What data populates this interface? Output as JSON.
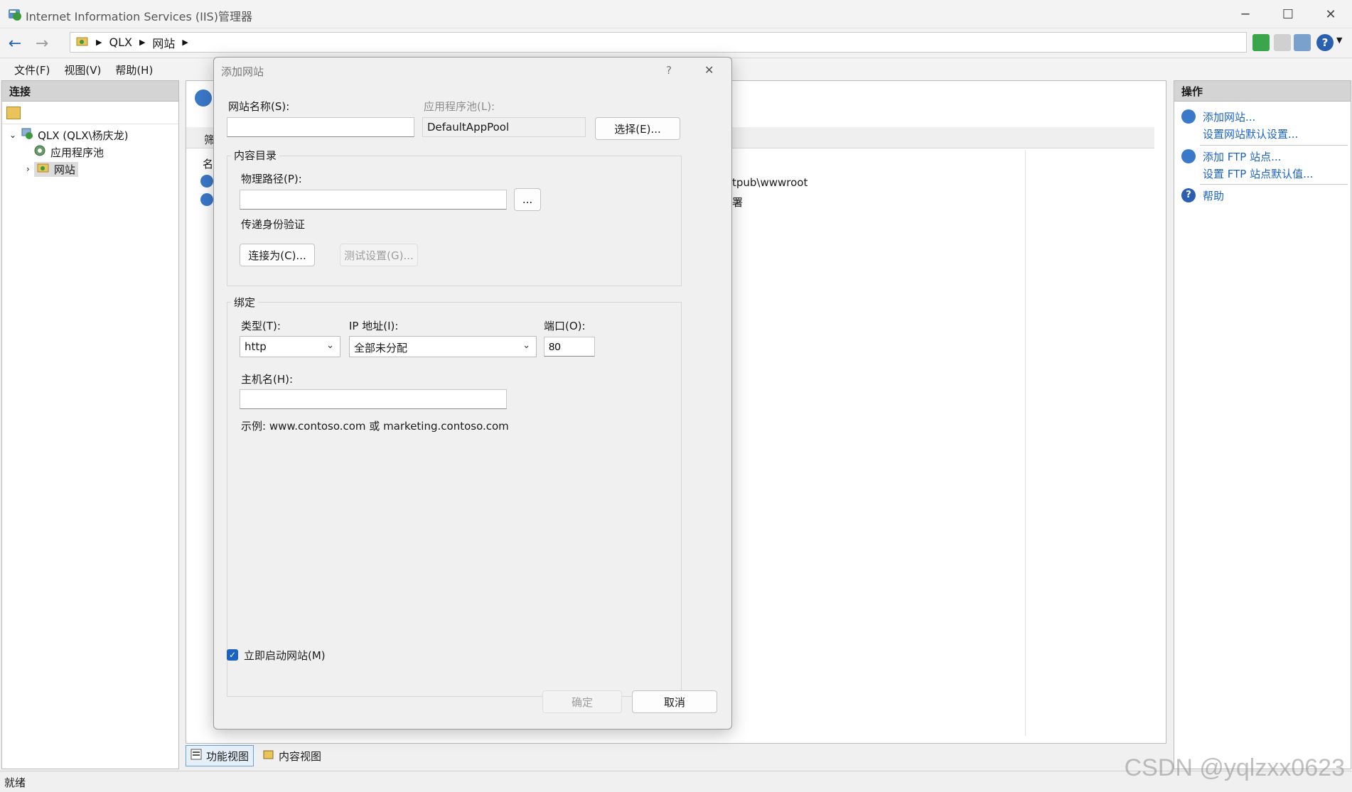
{
  "window": {
    "title": "Internet Information Services (IIS)管理器",
    "minimize_glyph": "─",
    "maximize_glyph": "☐",
    "close_glyph": "✕"
  },
  "addressbar": {
    "breadcrumbs": [
      "QLX",
      "网站"
    ]
  },
  "menu": [
    "文件(F)",
    "视图(V)",
    "帮助(H)"
  ],
  "left_panel": {
    "header": "连接",
    "tree": {
      "root": "QLX (QLX\\杨庆龙)",
      "child1": "应用程序池",
      "child2": "网站"
    }
  },
  "center": {
    "fragment_filter": "筛",
    "fragment_name": "名",
    "path_fragment": "tpub\\wwwroot",
    "status_fragment": "署"
  },
  "bottom_tabs": {
    "features": "功能视图",
    "content": "内容视图"
  },
  "right_panel": {
    "header": "操作",
    "actions": {
      "add_site": "添加网站...",
      "site_defaults": "设置网站默认设置...",
      "add_ftp": "添加 FTP 站点...",
      "ftp_defaults": "设置 FTP 站点默认值...",
      "help": "帮助"
    }
  },
  "statusbar": {
    "text": "就绪"
  },
  "watermark": "CSDN @yqlzxx0623",
  "dialog": {
    "title": "添加网站",
    "help_glyph": "?",
    "close_glyph": "✕",
    "site_name_label": "网站名称(S):",
    "site_name_value": "",
    "app_pool_label": "应用程序池(L):",
    "app_pool_value": "DefaultAppPool",
    "select_button": "选择(E)...",
    "content_dir_group": "内容目录",
    "physical_path_label": "物理路径(P):",
    "physical_path_value": "",
    "browse_button": "...",
    "pass_auth_label": "传递身份验证",
    "connect_as_button": "连接为(C)...",
    "test_settings_button": "测试设置(G)...",
    "binding_group": "绑定",
    "type_label": "类型(T):",
    "type_value": "http",
    "ip_label": "IP 地址(I):",
    "ip_value": "全部未分配",
    "port_label": "端口(O):",
    "port_value": "80",
    "hostname_label": "主机名(H):",
    "hostname_value": "",
    "example_text": "示例: www.contoso.com 或 marketing.contoso.com",
    "start_now_label": "立即启动网站(M)",
    "start_now_checked": true,
    "ok_button": "确定",
    "cancel_button": "取消"
  }
}
